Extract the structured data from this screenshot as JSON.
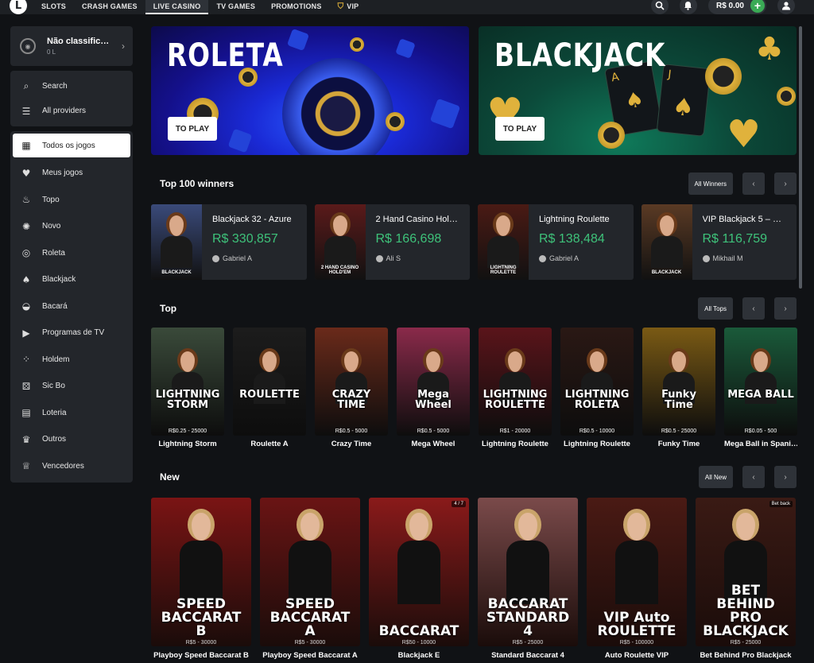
{
  "nav": {
    "logo": "L",
    "items": [
      "SLOTS",
      "CRASH GAMES",
      "LIVE CASINO",
      "TV GAMES",
      "PROMOTIONS",
      "VIP"
    ],
    "balance": "R$ 0.00"
  },
  "sidebar": {
    "profile": {
      "name": "Não classific…",
      "sub": "0 L"
    },
    "tools": [
      {
        "label": "Search",
        "icon": "search-icon"
      },
      {
        "label": "All providers",
        "icon": "sliders-icon"
      }
    ],
    "categories": [
      {
        "label": "Todos os jogos",
        "icon": "grid-icon",
        "active": true
      },
      {
        "label": "Meus jogos",
        "icon": "heart-icon"
      },
      {
        "label": "Topo",
        "icon": "fire-icon"
      },
      {
        "label": "Novo",
        "icon": "new-icon"
      },
      {
        "label": "Roleta",
        "icon": "roulette-icon"
      },
      {
        "label": "Blackjack",
        "icon": "cards-icon"
      },
      {
        "label": "Bacará",
        "icon": "baccarat-icon"
      },
      {
        "label": "Programas de TV",
        "icon": "play-icon"
      },
      {
        "label": "Holdem",
        "icon": "holdem-icon"
      },
      {
        "label": "Sic Bo",
        "icon": "dice-icon"
      },
      {
        "label": "Loteria",
        "icon": "lottery-icon"
      },
      {
        "label": "Outros",
        "icon": "crown-icon"
      },
      {
        "label": "Vencedores",
        "icon": "trophy-icon"
      }
    ]
  },
  "banners": [
    {
      "title": "ROLETA",
      "button": "TO PLAY"
    },
    {
      "title": "BLACKJACK",
      "button": "TO PLAY"
    }
  ],
  "winners": {
    "title": "Top 100 winners",
    "all_label": "All Winners",
    "items": [
      {
        "game": "Blackjack 32 - Azure",
        "amount": "R$ 330,857",
        "user": "Gabriel A",
        "thumb_label": "BLACKJACK",
        "color": "#3a4a7a"
      },
      {
        "game": "2 Hand Casino Hol…",
        "amount": "R$ 166,698",
        "user": "Ali S",
        "thumb_label": "2 HAND CASINO HOLD'EM",
        "color": "#5a1a1a"
      },
      {
        "game": "Lightning Roulette",
        "amount": "R$ 138,484",
        "user": "Gabriel A",
        "thumb_label": "LIGHTNING ROULETTE",
        "color": "#4a1a14"
      },
      {
        "game": "VIP Blackjack 5 – …",
        "amount": "R$ 116,759",
        "user": "Mikhail M",
        "thumb_label": "BLACKJACK",
        "color": "#5a3a24"
      }
    ]
  },
  "top": {
    "title": "Top",
    "all_label": "All Tops",
    "items": [
      {
        "name": "Lightning Storm",
        "brand": "LIGHTNING STORM",
        "limit": "R$0.25 - 25000",
        "color": "#3a4a3a"
      },
      {
        "name": "Roulette A",
        "brand": "ROULETTE",
        "limit": "",
        "color": "#1c1c1c"
      },
      {
        "name": "Crazy Time",
        "brand": "CRAZY TIME",
        "limit": "R$0.5 - 5000",
        "color": "#6a2a1a"
      },
      {
        "name": "Mega Wheel",
        "brand": "Mega Wheel",
        "limit": "R$0.5 - 5000",
        "color": "#8a2a4a"
      },
      {
        "name": "Lightning Roulette",
        "brand": "LIGHTNING ROULETTE",
        "limit": "R$1 - 20000",
        "color": "#5a141a"
      },
      {
        "name": "Lightning Roulette",
        "brand": "LIGHTNING ROLETA",
        "limit": "R$0.5 - 10000",
        "color": "#2a1814"
      },
      {
        "name": "Funky Time",
        "brand": "Funky Time",
        "limit": "R$0.5 - 25000",
        "color": "#7a5a14"
      },
      {
        "name": "Mega Ball in Spani…",
        "brand": "MEGA BALL",
        "limit": "R$0.05 - 500",
        "color": "#1a5a3a"
      }
    ]
  },
  "new": {
    "title": "New",
    "all_label": "All New",
    "items": [
      {
        "name": "Playboy Speed Baccarat B",
        "brand": "SPEED BACCARAT B",
        "limit": "R$5 - 30000",
        "color": "#7a1414",
        "badge": ""
      },
      {
        "name": "Playboy Speed Baccarat A",
        "brand": "SPEED BACCARAT A",
        "limit": "R$5 - 30000",
        "color": "#6a1414",
        "badge": ""
      },
      {
        "name": "Blackjack E",
        "brand": "BACCARAT",
        "limit": "R$50 - 10000",
        "color": "#8a1a1a",
        "badge": "4 / 7"
      },
      {
        "name": "Standard Baccarat 4",
        "brand": "BACCARAT STANDARD 4",
        "limit": "R$5 - 25000",
        "color": "#7a4a4a",
        "badge": ""
      },
      {
        "name": "Auto Roulette VIP",
        "brand": "VIP Auto ROULETTE",
        "limit": "R$5 - 100000",
        "color": "#4a1a14",
        "badge": ""
      },
      {
        "name": "Bet Behind Pro Blackjack",
        "brand": "BET BEHIND PRO BLACKJACK",
        "limit": "R$5 - 25000",
        "color": "#3a1a14",
        "badge": "Bet back"
      }
    ]
  }
}
